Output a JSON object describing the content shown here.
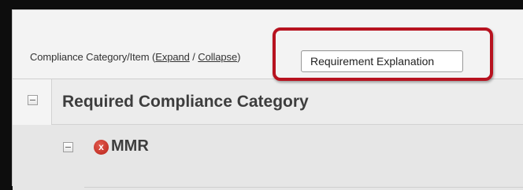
{
  "header": {
    "label_prefix": "Compliance Category/Item (",
    "expand_link": "Expand",
    "separator": " / ",
    "collapse_link": "Collapse",
    "label_suffix": ")",
    "requirement_button": "Requirement Explanation"
  },
  "category": {
    "title": "Required Compliance Category"
  },
  "item": {
    "status_icon_text": "x",
    "title": "MMR"
  },
  "colors": {
    "highlight": "#b7121f",
    "status_error": "#c62c22",
    "frame": "#0d0d0d"
  }
}
